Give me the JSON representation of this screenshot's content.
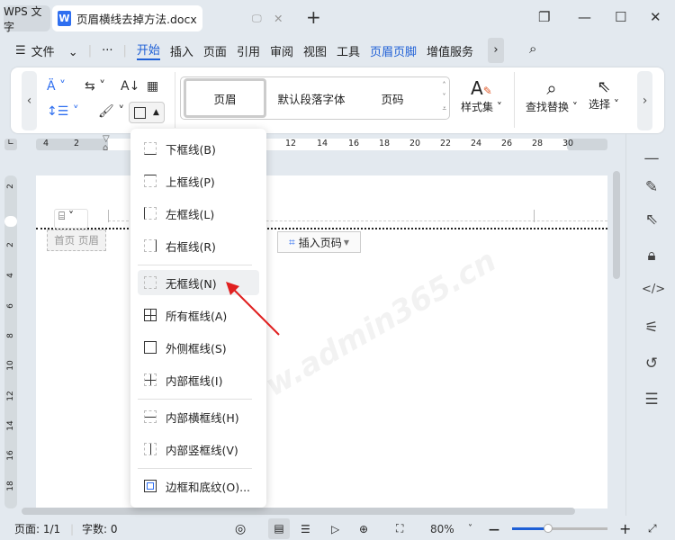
{
  "titlebar": {
    "home_tab": "WPS 文字",
    "doc_tab": "页眉横线去掉方法.docx",
    "doc_icon": "W"
  },
  "menu": {
    "file": "文件",
    "more": "···",
    "items": [
      "开始",
      "插入",
      "页面",
      "引用",
      "审阅",
      "视图",
      "工具",
      "页眉页脚",
      "增值服务"
    ],
    "active": "开始",
    "accent": "#1e5fd6"
  },
  "ribbon": {
    "styles": [
      "页眉",
      "默认段落字体",
      "页码"
    ],
    "style_set": "样式集",
    "find_replace": "查找替换",
    "select": "选择"
  },
  "ruler": {
    "h_left": [
      "4",
      "2"
    ],
    "h_right": [
      "12",
      "14",
      "16",
      "18",
      "20",
      "22",
      "24",
      "26",
      "28",
      "30"
    ],
    "v": [
      "2",
      "2",
      "4",
      "6",
      "8",
      "10",
      "12",
      "14",
      "16",
      "18"
    ]
  },
  "document": {
    "header_label": "首页 页眉",
    "insert_page_number": "插入页码",
    "watermark": "www.admin365.cn"
  },
  "border_menu": {
    "items": [
      {
        "label": "下框线(B)",
        "icon": "border-bottom-icon"
      },
      {
        "label": "上框线(P)",
        "icon": "border-top-icon"
      },
      {
        "label": "左框线(L)",
        "icon": "border-left-icon"
      },
      {
        "label": "右框线(R)",
        "icon": "border-right-icon"
      },
      {
        "label": "无框线(N)",
        "icon": "border-none-icon",
        "highlighted": true
      },
      {
        "label": "所有框线(A)",
        "icon": "border-all-icon"
      },
      {
        "label": "外侧框线(S)",
        "icon": "border-outside-icon"
      },
      {
        "label": "内部框线(I)",
        "icon": "border-inside-icon"
      },
      {
        "label": "内部横框线(H)",
        "icon": "border-inside-horizontal-icon"
      },
      {
        "label": "内部竖框线(V)",
        "icon": "border-inside-vertical-icon"
      },
      {
        "label": "边框和底纹(O)...",
        "icon": "borders-shading-icon"
      }
    ]
  },
  "status": {
    "page": "页面: 1/1",
    "words": "字数: 0",
    "zoom": "80%",
    "zoom_percent": 80
  }
}
